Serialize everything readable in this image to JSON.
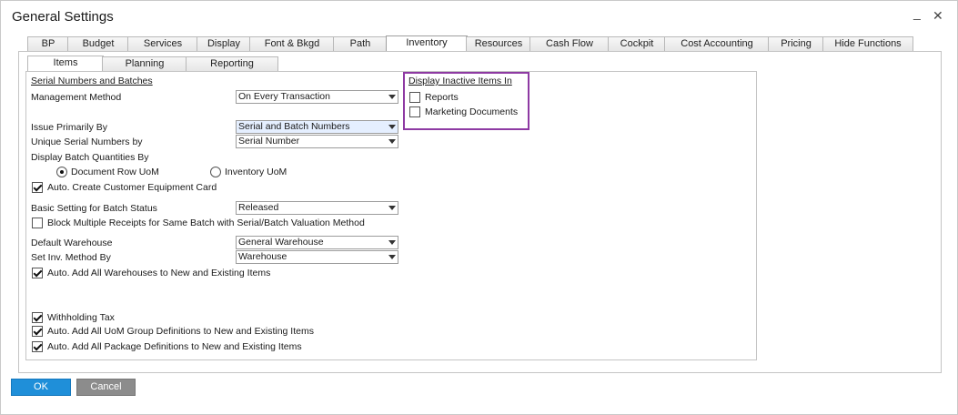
{
  "window": {
    "title": "General Settings",
    "minimize": "_",
    "close": "✕"
  },
  "tabs": [
    {
      "label": "BP"
    },
    {
      "label": "Budget"
    },
    {
      "label": "Services"
    },
    {
      "label": "Display"
    },
    {
      "label": "Font & Bkgd"
    },
    {
      "label": "Path"
    },
    {
      "label": "Inventory"
    },
    {
      "label": "Resources"
    },
    {
      "label": "Cash Flow"
    },
    {
      "label": "Cockpit"
    },
    {
      "label": "Cost Accounting"
    },
    {
      "label": "Pricing"
    },
    {
      "label": "Hide Functions"
    }
  ],
  "active_tab": "Inventory",
  "subtabs": [
    {
      "label": "Items"
    },
    {
      "label": "Planning"
    },
    {
      "label": "Reporting"
    }
  ],
  "serial": {
    "section_title": "Serial Numbers and Batches",
    "management_method": {
      "label": "Management Method",
      "value": "On Every Transaction"
    },
    "issue_primarily_by": {
      "label": "Issue Primarily By",
      "value": "Serial and Batch Numbers"
    },
    "unique_serial_by": {
      "label": "Unique Serial Numbers by",
      "value": "Serial Number"
    },
    "display_batch_qty": {
      "label": "Display Batch Quantities By",
      "opt_doc_row": "Document Row UoM",
      "opt_inventory": "Inventory UoM"
    },
    "auto_create_equipment": "Auto. Create Customer Equipment Card",
    "basic_batch_status": {
      "label": "Basic Setting for Batch Status",
      "value": "Released"
    },
    "block_multiple_receipts": "Block Multiple Receipts for Same Batch with Serial/Batch Valuation Method"
  },
  "warehouse": {
    "default_warehouse": {
      "label": "Default Warehouse",
      "value": "General Warehouse"
    },
    "set_inv_method": {
      "label": "Set Inv. Method By",
      "value": "Warehouse"
    },
    "auto_add_warehouses": "Auto. Add All Warehouses to New and Existing Items"
  },
  "misc": {
    "withholding_tax": "Withholding Tax",
    "auto_add_uom": "Auto. Add All UoM Group Definitions to New and Existing Items",
    "auto_add_package": "Auto. Add All Package Definitions to New and Existing Items"
  },
  "inactive": {
    "title": "Display Inactive Items In",
    "reports": "Reports",
    "marketing": "Marketing Documents"
  },
  "buttons": {
    "ok": "OK",
    "cancel": "Cancel"
  }
}
